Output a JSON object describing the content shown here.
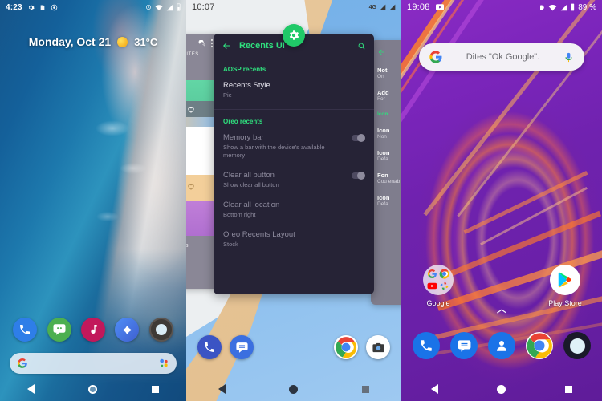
{
  "panels": [
    {
      "id": "pixel-launcher-blue",
      "status": {
        "time": "4:23",
        "icons": [
          "gear-icon",
          "sim-icon",
          "record-icon",
          "cast-icon",
          "wifi-icon",
          "signal-icon",
          "battery-icon"
        ]
      },
      "widget": {
        "date": "Monday, Oct 21",
        "weather_icon": "sun-icon",
        "temperature": "31°C"
      },
      "dock": [
        {
          "name": "phone",
          "label": "Phone"
        },
        {
          "name": "messages",
          "label": "Messages"
        },
        {
          "name": "music",
          "label": "Music"
        },
        {
          "name": "maps",
          "label": "Maps"
        },
        {
          "name": "camera",
          "label": "Camera"
        }
      ],
      "search": {
        "icon": "google-g-icon",
        "assistant_icon": "assistant-icon",
        "placeholder": ""
      },
      "nav": {
        "back": "back-icon",
        "home": "home-icon",
        "recents": "recents-icon"
      }
    },
    {
      "id": "recents-ui-settings",
      "status": {
        "time": "10:07",
        "network": "4G"
      },
      "fab": {
        "icon": "gear-icon"
      },
      "appbar": {
        "back_icon": "back-arrow-icon",
        "title": "Recents UI",
        "search_icon": "search-icon"
      },
      "sections": [
        {
          "header": "AOSP recents",
          "rows": [
            {
              "title": "Recents Style",
              "summary": "Pie",
              "toggle": null,
              "dim": false
            }
          ]
        },
        {
          "header": "Oreo recents",
          "rows": [
            {
              "title": "Memory bar",
              "summary": "Show a bar with the device's available memory",
              "toggle": "on",
              "dim": true
            },
            {
              "title": "Clear all button",
              "summary": "Show clear all button",
              "toggle": "on",
              "dim": true
            },
            {
              "title": "Clear all location",
              "summary": "Bottom right",
              "toggle": null,
              "dim": true
            },
            {
              "title": "Oreo Recents Layout",
              "summary": "Stock",
              "toggle": null,
              "dim": true
            }
          ]
        }
      ],
      "left_card": {
        "toolbar_icons": [
          "refresh-icon",
          "overflow-icon"
        ],
        "tab": "FAVORITES",
        "footer": "screens",
        "hearts": [
          "heart-outline-icon",
          "heart-outline-icon",
          "heart-outline-icon"
        ]
      },
      "right_card": {
        "back_icon": "back-arrow-icon",
        "rows": [
          {
            "title": "Not",
            "summary": "On"
          },
          {
            "title": "Add",
            "summary": "For"
          },
          {
            "title": "Icon",
            "summary": "",
            "accent": true
          },
          {
            "title": "Icon",
            "summary": "Non"
          },
          {
            "title": "Icon",
            "summary": "Defa"
          },
          {
            "title": "Fon",
            "summary": "Cou enab"
          },
          {
            "title": "Icon",
            "summary": "Defa"
          }
        ]
      },
      "dock": [
        {
          "name": "phone",
          "label": "Phone"
        },
        {
          "name": "messages",
          "label": "Messages"
        },
        {
          "name": "chrome",
          "label": "Chrome"
        },
        {
          "name": "camera",
          "label": "Camera"
        }
      ],
      "nav": {
        "back": "back-icon",
        "home": "home-icon",
        "recents": "recents-icon"
      }
    },
    {
      "id": "purple-launcher",
      "status": {
        "time": "19:08",
        "icons": [
          "youtube-icon",
          "vibrate-icon",
          "wifi-icon",
          "signal-icon",
          "battery-icon"
        ],
        "battery": "89 %"
      },
      "search": {
        "icon": "google-g-icon",
        "placeholder": "Dites \"Ok Google\".",
        "mic_icon": "microphone-icon"
      },
      "apps": [
        {
          "name": "google-folder",
          "label": "Google",
          "contents": [
            "google-g-icon",
            "chrome-icon",
            "youtube-icon",
            "photos-icon"
          ]
        },
        {
          "name": "play-store",
          "label": "Play Store"
        }
      ],
      "drawer_handle": "chevron-up-icon",
      "dock": [
        {
          "name": "phone",
          "label": "Phone"
        },
        {
          "name": "messages",
          "label": "Messages"
        },
        {
          "name": "contacts",
          "label": "Contacts"
        },
        {
          "name": "chrome",
          "label": "Chrome"
        },
        {
          "name": "camera",
          "label": "Camera"
        }
      ],
      "nav": {
        "back": "back-icon",
        "home": "home-icon",
        "recents": "recents-icon"
      }
    }
  ],
  "colors": {
    "accent_green": "#2fe07e",
    "card_dark": "#262336",
    "purple_wall": "#6f22ae",
    "blue_wall": "#15558a"
  }
}
